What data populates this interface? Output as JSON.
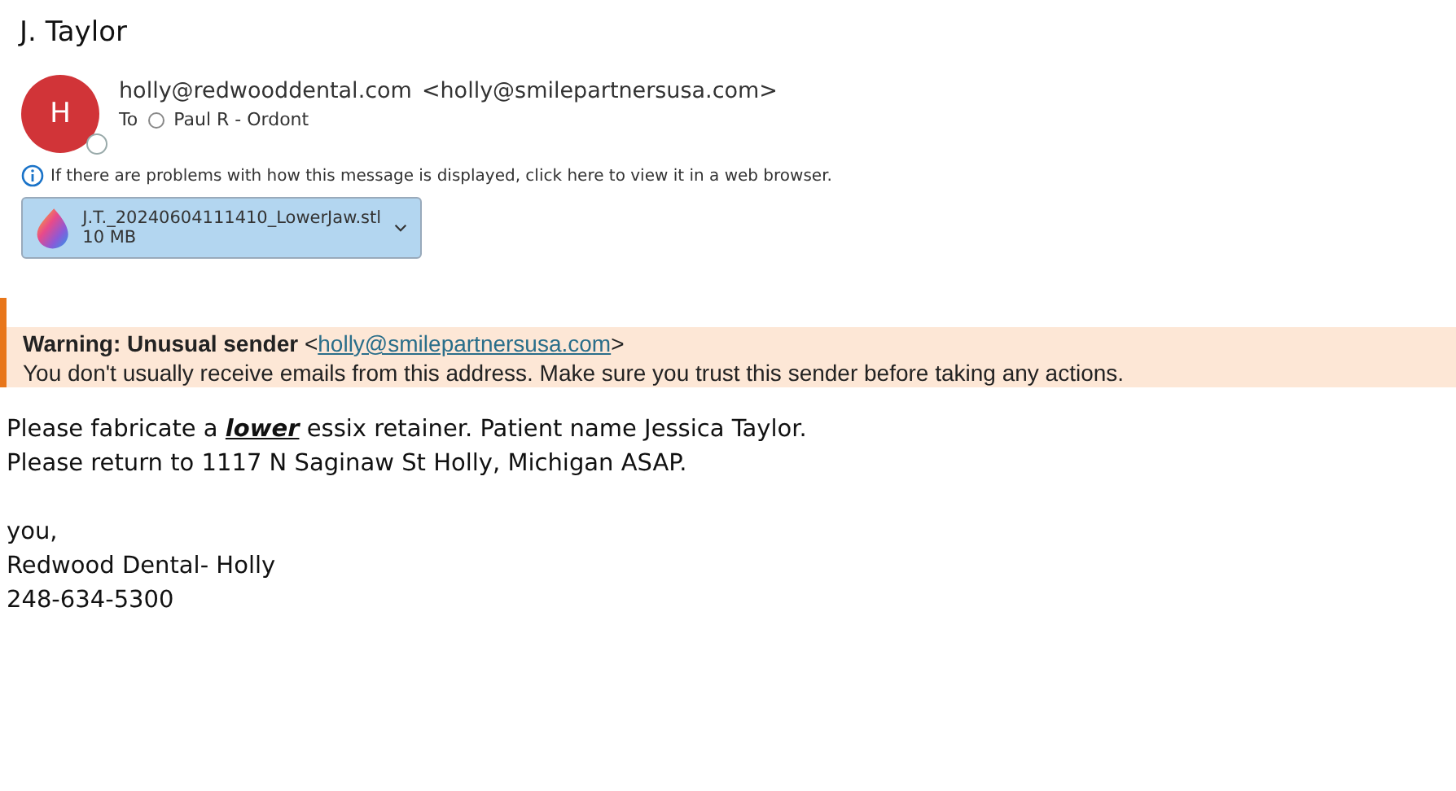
{
  "subject": "J. Taylor",
  "sender": {
    "initial": "H",
    "name": "holly@redwooddental.com",
    "address": "<holly@smilepartnersusa.com>"
  },
  "to": {
    "label": "To",
    "recipient": "Paul R - Ordont"
  },
  "info_bar": "If there are problems with how this message is displayed, click here to view it in a web browser.",
  "attachment": {
    "name": "J.T._20240604111410_LowerJaw.stl",
    "size": "10 MB"
  },
  "warning": {
    "title_start": "**Warning: Unusual sender** <",
    "link": "holly@smilepartnersusa.com",
    "title_end": ">",
    "message": "You don't usually receive emails from this address. Make sure you trust this sender before taking any actions."
  },
  "body": [
    {
      "lines": [
        "Please fabricate a **lower** essix retainer. Patient name Jessica Taylor.",
        "Please return to 1117 N Saginaw St Holly, Michigan ASAP."
      ]
    },
    {
      "lines": [
        "you,",
        "Redwood Dental- Holly",
        "248-634-5300"
      ]
    }
  ]
}
